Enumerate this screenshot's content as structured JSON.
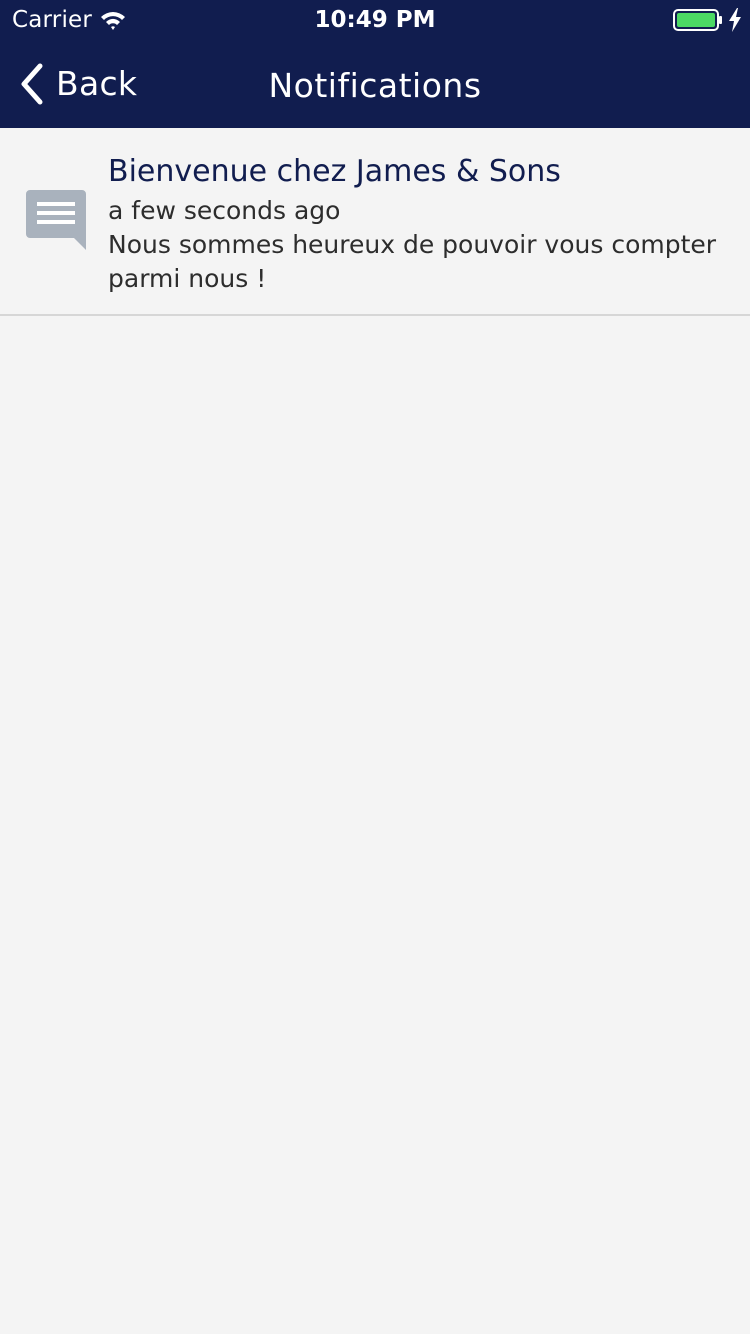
{
  "status_bar": {
    "carrier": "Carrier",
    "time": "10:49 PM",
    "wifi_icon": "wifi-icon",
    "battery_icon": "battery-full-icon",
    "charging_icon": "charging-bolt-icon",
    "battery_color": "#4cd964"
  },
  "nav": {
    "back_label": "Back",
    "back_icon": "chevron-left-icon",
    "title": "Notifications",
    "background_color": "#111d4f"
  },
  "notifications": [
    {
      "icon": "message-icon",
      "title": "Bienvenue chez James & Sons",
      "time": "a few seconds ago",
      "body": "Nous sommes heureux de pouvoir vous compter parmi nous !"
    }
  ]
}
